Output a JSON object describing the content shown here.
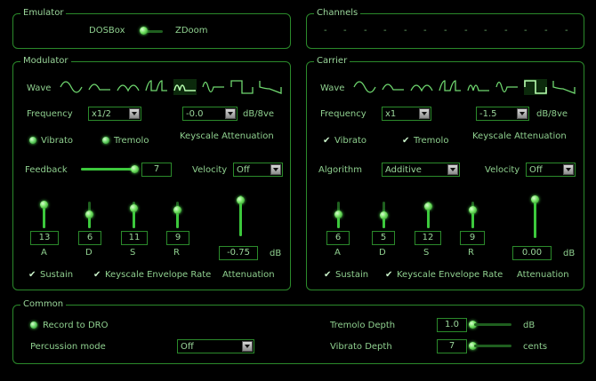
{
  "emulator": {
    "title": "Emulator",
    "left_option": "DOSBox",
    "right_option": "ZDoom"
  },
  "channels": {
    "title": "Channels",
    "items": [
      "-",
      "-",
      "-",
      "-",
      "-",
      "-",
      "-",
      "-",
      "-",
      "-",
      "-",
      "-",
      "-"
    ]
  },
  "modulator": {
    "title": "Modulator",
    "wave_label": "Wave",
    "frequency_label": "Frequency",
    "frequency_value": "x1/2",
    "keyscale_value": "-0.0",
    "keyscale_unit": "dB/8ve",
    "vibrato_label": "Vibrato",
    "tremolo_label": "Tremolo",
    "keyscale_label": "Keyscale Attenuation",
    "feedback_label": "Feedback",
    "feedback_value": "7",
    "velocity_label": "Velocity",
    "velocity_value": "Off",
    "adsr": [
      {
        "label": "A",
        "value": "13"
      },
      {
        "label": "D",
        "value": "6"
      },
      {
        "label": "S",
        "value": "11"
      },
      {
        "label": "R",
        "value": "9"
      }
    ],
    "attenuation_value": "-0.75",
    "attenuation_unit": "dB",
    "attenuation_label": "Attenuation",
    "sustain_label": "Sustain",
    "ker_label": "Keyscale Envelope Rate"
  },
  "carrier": {
    "title": "Carrier",
    "wave_label": "Wave",
    "frequency_label": "Frequency",
    "frequency_value": "x1",
    "keyscale_value": "-1.5",
    "keyscale_unit": "dB/8ve",
    "vibrato_label": "Vibrato",
    "tremolo_label": "Tremolo",
    "keyscale_label": "Keyscale Attenuation",
    "algorithm_label": "Algorithm",
    "algorithm_value": "Additive",
    "velocity_label": "Velocity",
    "velocity_value": "Off",
    "adsr": [
      {
        "label": "A",
        "value": "6"
      },
      {
        "label": "D",
        "value": "5"
      },
      {
        "label": "S",
        "value": "12"
      },
      {
        "label": "R",
        "value": "9"
      }
    ],
    "attenuation_value": "0.00",
    "attenuation_unit": "dB",
    "attenuation_label": "Attenuation",
    "sustain_label": "Sustain",
    "ker_label": "Keyscale Envelope Rate"
  },
  "common": {
    "title": "Common",
    "record_label": "Record to DRO",
    "percussion_label": "Percussion mode",
    "percussion_value": "Off",
    "tremolo_depth_label": "Tremolo Depth",
    "tremolo_depth_value": "1.0",
    "tremolo_depth_unit": "dB",
    "vibrato_depth_label": "Vibrato Depth",
    "vibrato_depth_value": "7",
    "vibrato_depth_unit": "cents"
  },
  "colors": {
    "background": "#000000",
    "border": "#2b8a2b",
    "accent": "#3cc83c",
    "text": "#8fd08f"
  }
}
